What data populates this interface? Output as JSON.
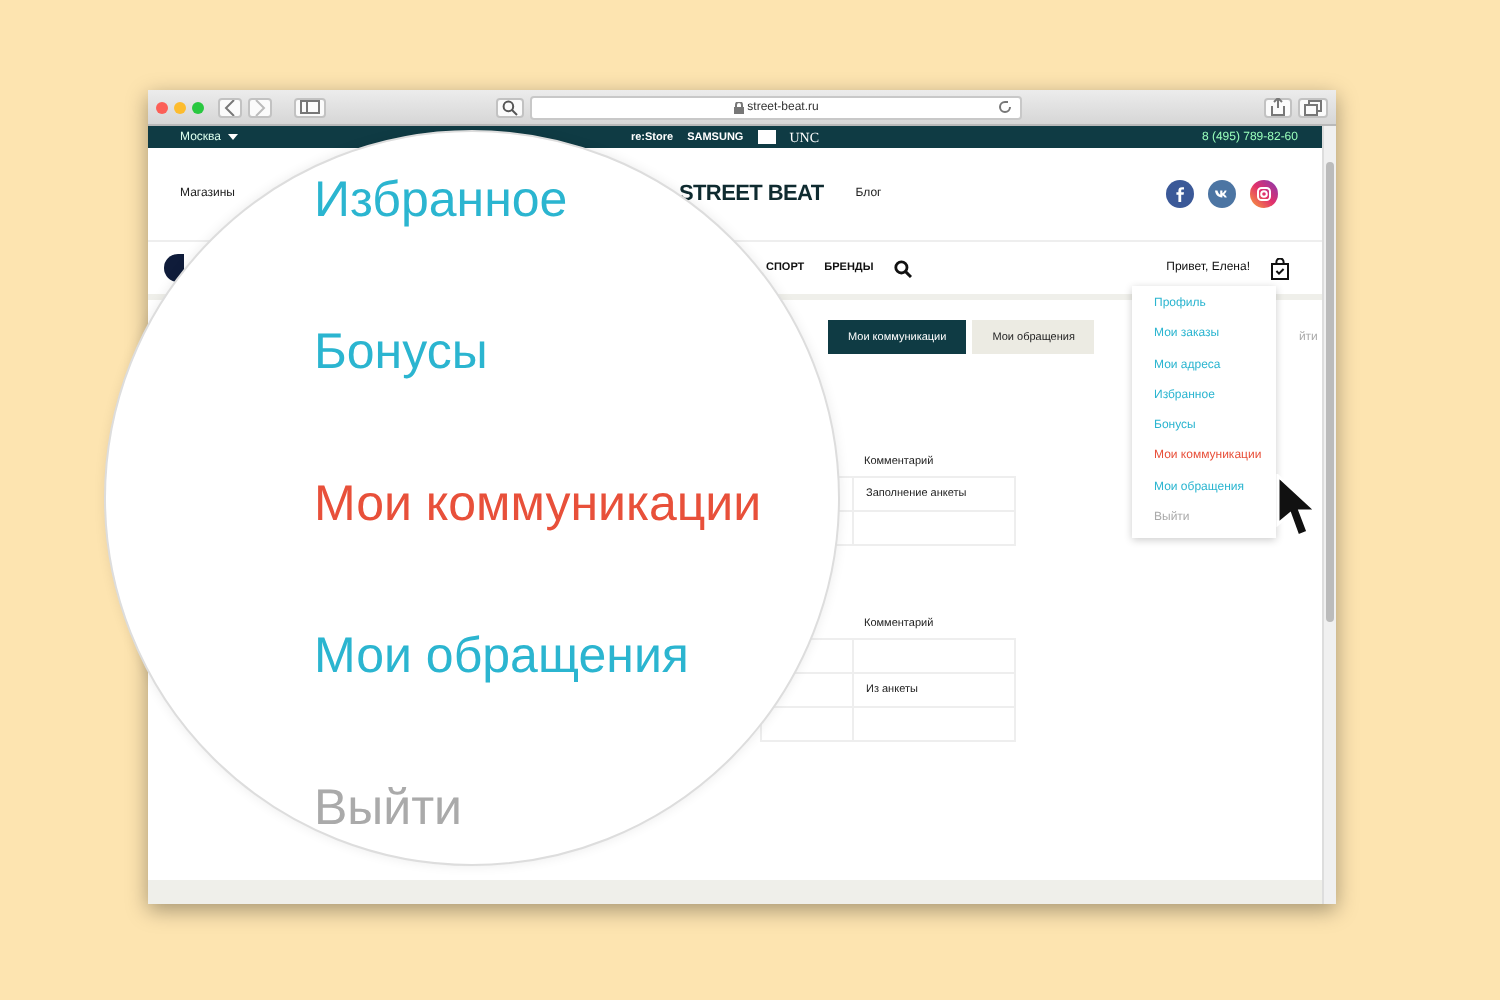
{
  "browser": {
    "url": "street-beat.ru"
  },
  "top_bar": {
    "city": "Москва",
    "brands": [
      "re:Store",
      "SAMSUNG",
      "UNC"
    ],
    "phone": "8 (495) 789-82-60"
  },
  "header": {
    "left_link": "Магазины",
    "logo": "STREET BEAT",
    "right_link": "Блог"
  },
  "nav": {
    "items": [
      "СПОРТ",
      "БРЕНДЫ"
    ],
    "greeting": "Привет, Елена!"
  },
  "tabs": [
    {
      "label": "Мои коммуникации",
      "selected": true
    },
    {
      "label": "Мои обращения",
      "selected": false
    }
  ],
  "tabs_trailing": "йти",
  "tables": [
    {
      "header": "Комментарий",
      "rows": [
        "Заполнение анкеты",
        null
      ]
    },
    {
      "header": "Комментарий",
      "rows": [
        null,
        "Из анкеты",
        null
      ]
    }
  ],
  "dropdown": {
    "items": [
      {
        "label": "Профиль",
        "kind": "link",
        "selected": false
      },
      {
        "label": "Мои заказы",
        "kind": "link",
        "selected": false
      },
      {
        "label": "Мои адреса",
        "kind": "link",
        "selected": false
      },
      {
        "label": "Избранное",
        "kind": "link",
        "selected": false
      },
      {
        "label": "Бонусы",
        "kind": "link",
        "selected": false
      },
      {
        "label": "Мои коммуникации",
        "kind": "link",
        "selected": true
      },
      {
        "label": "Мои обращения",
        "kind": "link",
        "selected": false
      },
      {
        "label": "Выйти",
        "kind": "logout",
        "selected": false
      }
    ]
  },
  "magnifier": {
    "items": [
      {
        "label": "Избранное",
        "kind": "link",
        "selected": false
      },
      {
        "label": "Бонусы",
        "kind": "link",
        "selected": false
      },
      {
        "label": "Мои коммуникации",
        "kind": "link",
        "selected": true
      },
      {
        "label": "Мои обращения",
        "kind": "link",
        "selected": false
      },
      {
        "label": "Выйти",
        "kind": "logout",
        "selected": false
      }
    ]
  }
}
